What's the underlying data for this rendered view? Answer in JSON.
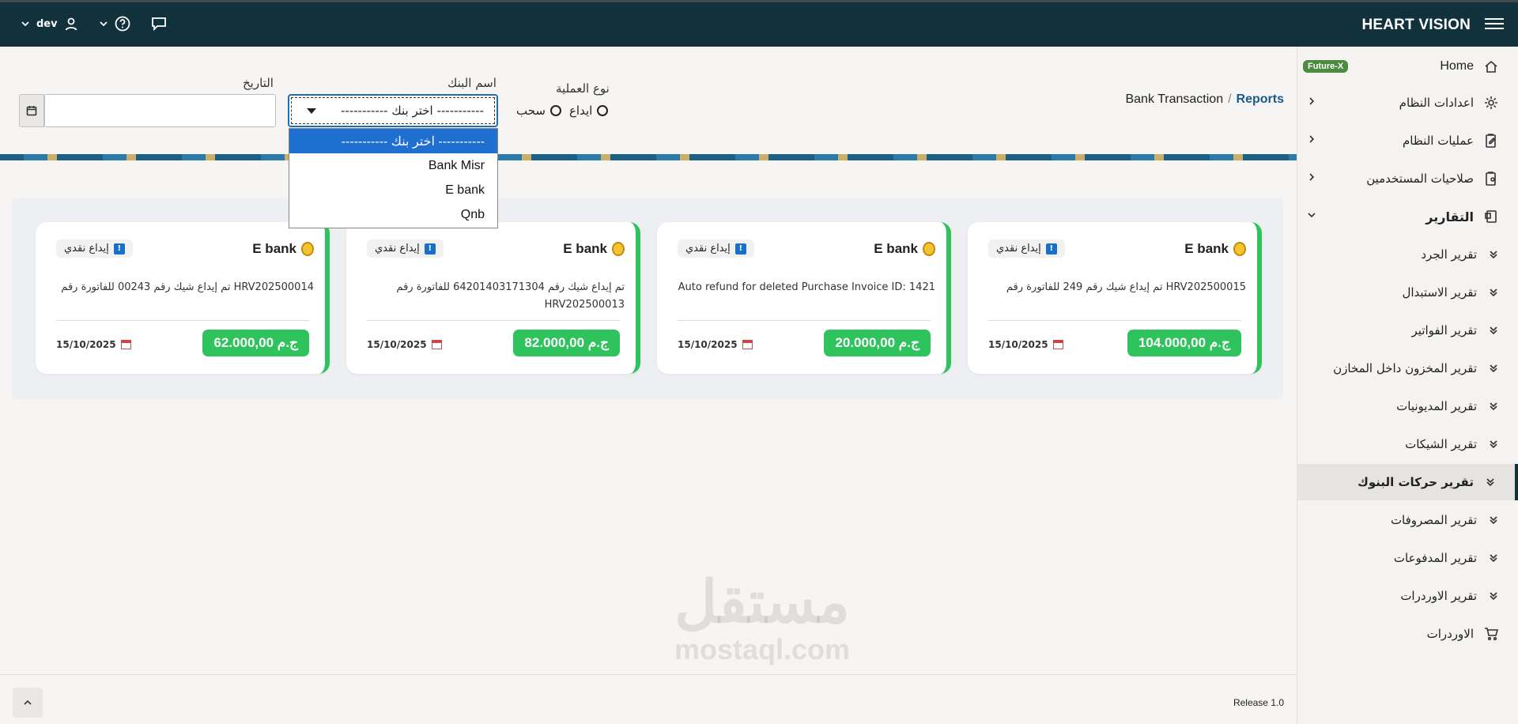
{
  "topbar": {
    "brand": "HEART VISION",
    "user": "dev"
  },
  "sidebar": {
    "home": "Home",
    "badge": "Future-X",
    "items": [
      {
        "label": "اعدادات النظام"
      },
      {
        "label": "عمليات النظام"
      },
      {
        "label": "صلاحيات المستخدمين"
      },
      {
        "label": "التقارير"
      }
    ],
    "reports": [
      {
        "label": "تقرير الجرد"
      },
      {
        "label": "تقرير الاستبدال"
      },
      {
        "label": "تقرير الفواتير"
      },
      {
        "label": "تقرير المخزون داخل المخازن"
      },
      {
        "label": "تقرير المديونيات"
      },
      {
        "label": "تقرير الشيكات"
      },
      {
        "label": "تقرير حركات البنوك"
      },
      {
        "label": "تقرير المصروفات"
      },
      {
        "label": "تقرير المدفوعات"
      },
      {
        "label": "تقرير الاوردرات"
      }
    ],
    "orders": "الاوردرات"
  },
  "breadcrumb": {
    "current": "Bank Transaction",
    "parent": "Reports"
  },
  "filters": {
    "operation_label": "نوع العملية",
    "deposit": "ايداع",
    "withdraw": "سحب",
    "bank_label": "اسم البنك",
    "bank_selected": "----------- اختر بنك -----------",
    "bank_options": [
      "----------- اختر بنك -----------",
      "Bank Misr",
      "E bank",
      "Qnb"
    ],
    "date_label": "التاريخ",
    "date_value": ""
  },
  "cards": [
    {
      "bank": "E bank",
      "type": "إيداع نقدي",
      "desc": "تم إيداع شيك رقم 249 للفاتورة رقم HRV202500015",
      "amount": "104.000,00 ج.م",
      "date": "15/10/2025"
    },
    {
      "bank": "E bank",
      "type": "إيداع نقدي",
      "desc": "Auto refund for deleted Purchase Invoice ID: 1421",
      "amount": "20.000,00 ج.م",
      "date": "15/10/2025"
    },
    {
      "bank": "E bank",
      "type": "إيداع نقدي",
      "desc": "تم إيداع شيك رقم 64201403171304 للفاتورة رقم HRV202500013",
      "amount": "82.000,00 ج.م",
      "date": "15/10/2025"
    },
    {
      "bank": "E bank",
      "type": "إيداع نقدي",
      "desc": "تم إيداع شيك رقم 00243 للفاتورة رقم HRV202500014",
      "amount": "62.000,00 ج.م",
      "date": "15/10/2025"
    }
  ],
  "watermark": {
    "ar": "مستقل",
    "en": "mostaql.com"
  },
  "footer": {
    "release": "Release 1.0"
  }
}
